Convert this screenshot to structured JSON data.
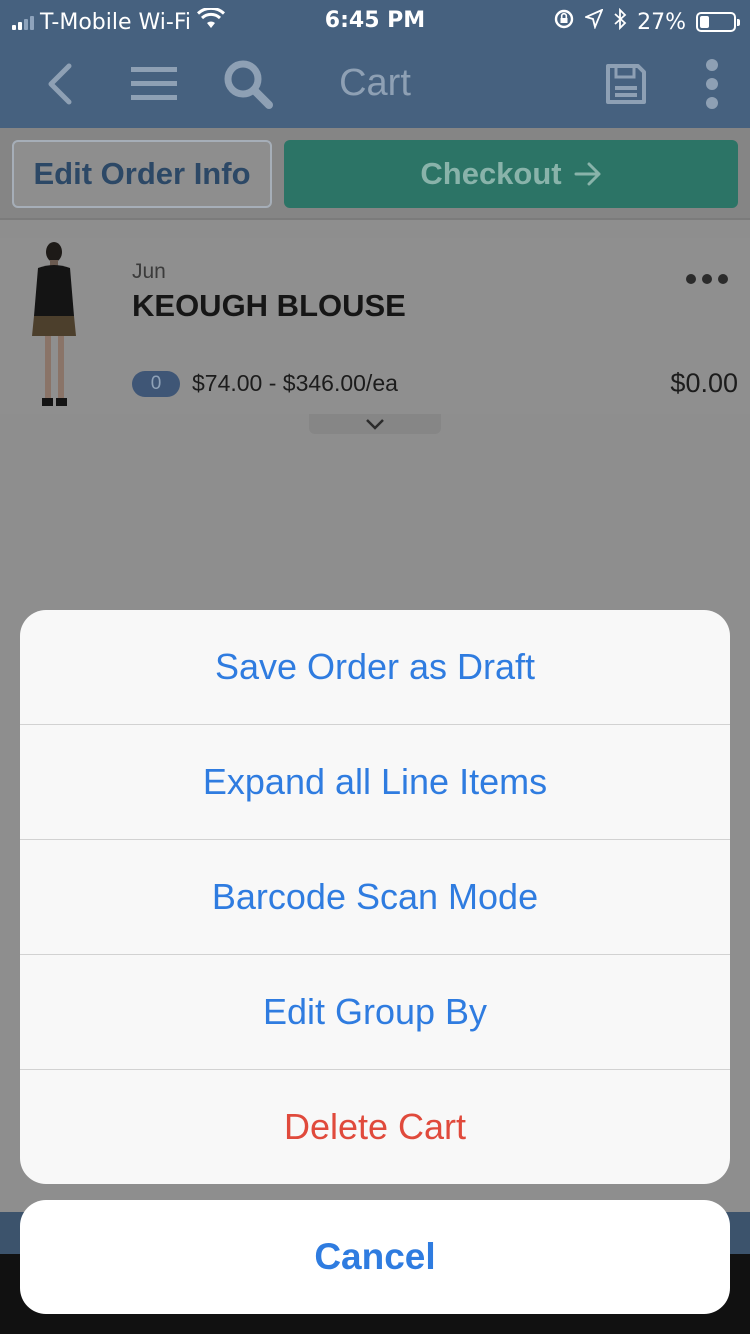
{
  "status_bar": {
    "carrier": "T-Mobile Wi-Fi",
    "time": "6:45 PM",
    "battery_percent": "27%",
    "battery_level": 0.27,
    "icons": [
      "wifi-icon",
      "rotation-lock-icon",
      "location-icon",
      "bluetooth-icon",
      "battery-icon"
    ]
  },
  "nav": {
    "title": "Cart",
    "icons": [
      "back-chevron-icon",
      "menu-icon",
      "search-icon",
      "save-icon",
      "more-vertical-icon"
    ]
  },
  "actions": {
    "edit_order_label": "Edit Order Info",
    "checkout_label": "Checkout",
    "checkout_icon": "arrow-right-icon"
  },
  "line_item": {
    "brand": "Jun",
    "name": "KEOUGH BLOUSE",
    "quantity": "0",
    "price_range": "$74.00 - $346.00/ea",
    "total": "$0.00"
  },
  "action_sheet": {
    "options": [
      {
        "label": "Save Order as Draft",
        "style": "default"
      },
      {
        "label": "Expand all Line Items",
        "style": "default"
      },
      {
        "label": "Barcode Scan Mode",
        "style": "default"
      },
      {
        "label": "Edit Group By",
        "style": "default"
      },
      {
        "label": "Delete Cart",
        "style": "destructive"
      }
    ],
    "cancel_label": "Cancel"
  },
  "colors": {
    "header": "#46617f",
    "checkout": "#2c7466",
    "ios_blue": "#2f7ce0",
    "destructive_red": "#e04a3c"
  }
}
